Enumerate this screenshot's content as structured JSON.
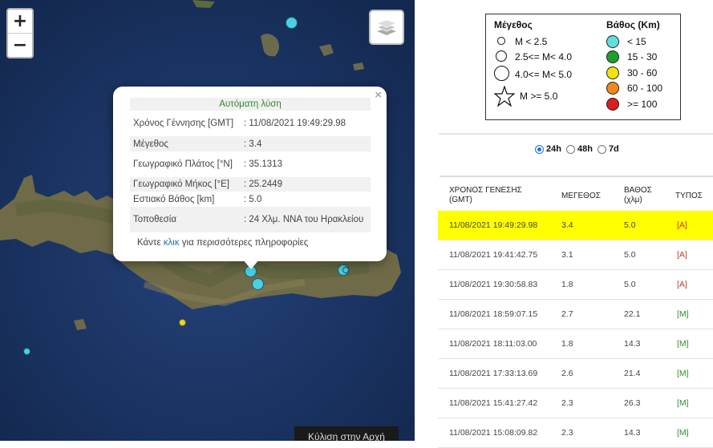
{
  "map": {
    "zoom_in": "+",
    "zoom_out": "−",
    "scroll_button": "Κύλιση στην Αρχή",
    "popup": {
      "close": "×",
      "header": "Αυτόματη λύση",
      "rows": [
        {
          "label": "Χρόνος Γέννησης [GMT]",
          "value": ": 11/08/2021 19:49:29.98"
        },
        {
          "label": "Μέγεθος",
          "value": ": 3.4"
        },
        {
          "label": "Γεωγραφικό Πλάτος [°N]",
          "value": ": 35.1313"
        },
        {
          "label": "Γεωγραφικό Μήκος [°E]",
          "value": ": 25.2449"
        },
        {
          "label": "Εστιακό Βάθος [km]",
          "value": ": 5.0"
        },
        {
          "label": "Τοποθεσία",
          "value": ": 24 Χλμ. ΝΝΑ του Ηρακλείου"
        }
      ],
      "more_prefix": "Κάντε ",
      "more_link": "κλικ",
      "more_suffix": " για περισσότερες πληροφορίες"
    }
  },
  "legend": {
    "magnitude_title": "Μέγεθος",
    "magnitude": [
      "M < 2.5",
      "2.5<= M< 4.0",
      "4.0<= M< 5.0",
      "M >= 5.0"
    ],
    "depth_title": "Βάθος (Km)",
    "depth": [
      {
        "label": "< 15",
        "color": "#5fe0de"
      },
      {
        "label": "15 - 30",
        "color": "#1fa02a"
      },
      {
        "label": "30 - 60",
        "color": "#f2e30f"
      },
      {
        "label": "60 - 100",
        "color": "#f08a1c"
      },
      {
        "label": ">= 100",
        "color": "#d71f1f"
      }
    ]
  },
  "filters": {
    "options": [
      "24h",
      "48h",
      "7d"
    ],
    "selected": "24h"
  },
  "table": {
    "headers": {
      "time": "ΧΡΟΝΟΣ ΓΕΝΕΣΗΣ (GMT)",
      "magnitude": "ΜΕΓΕΘΟΣ",
      "depth": "ΒΑΘΟΣ (χλμ)",
      "type": "ΤΥΠΟΣ"
    },
    "rows": [
      {
        "time": "11/08/2021 19:49:29.98",
        "mag": "3.4",
        "depth": "5.0",
        "type": "[A]"
      },
      {
        "time": "11/08/2021 19:41:42.75",
        "mag": "3.1",
        "depth": "5.0",
        "type": "[A]"
      },
      {
        "time": "11/08/2021 19:30:58.83",
        "mag": "1.8",
        "depth": "5.0",
        "type": "[A]"
      },
      {
        "time": "11/08/2021 18:59:07.15",
        "mag": "2.7",
        "depth": "22.1",
        "type": "[M]"
      },
      {
        "time": "11/08/2021 18:11:03.00",
        "mag": "1.8",
        "depth": "14.3",
        "type": "[M]"
      },
      {
        "time": "11/08/2021 17:33:13.69",
        "mag": "2.6",
        "depth": "21.4",
        "type": "[M]"
      },
      {
        "time": "11/08/2021 15:41:27.42",
        "mag": "2.3",
        "depth": "26.3",
        "type": "[M]"
      },
      {
        "time": "11/08/2021 15:08:09.82",
        "mag": "2.3",
        "depth": "14.3",
        "type": "[M]"
      }
    ],
    "highlight_color": "#ffff00"
  }
}
